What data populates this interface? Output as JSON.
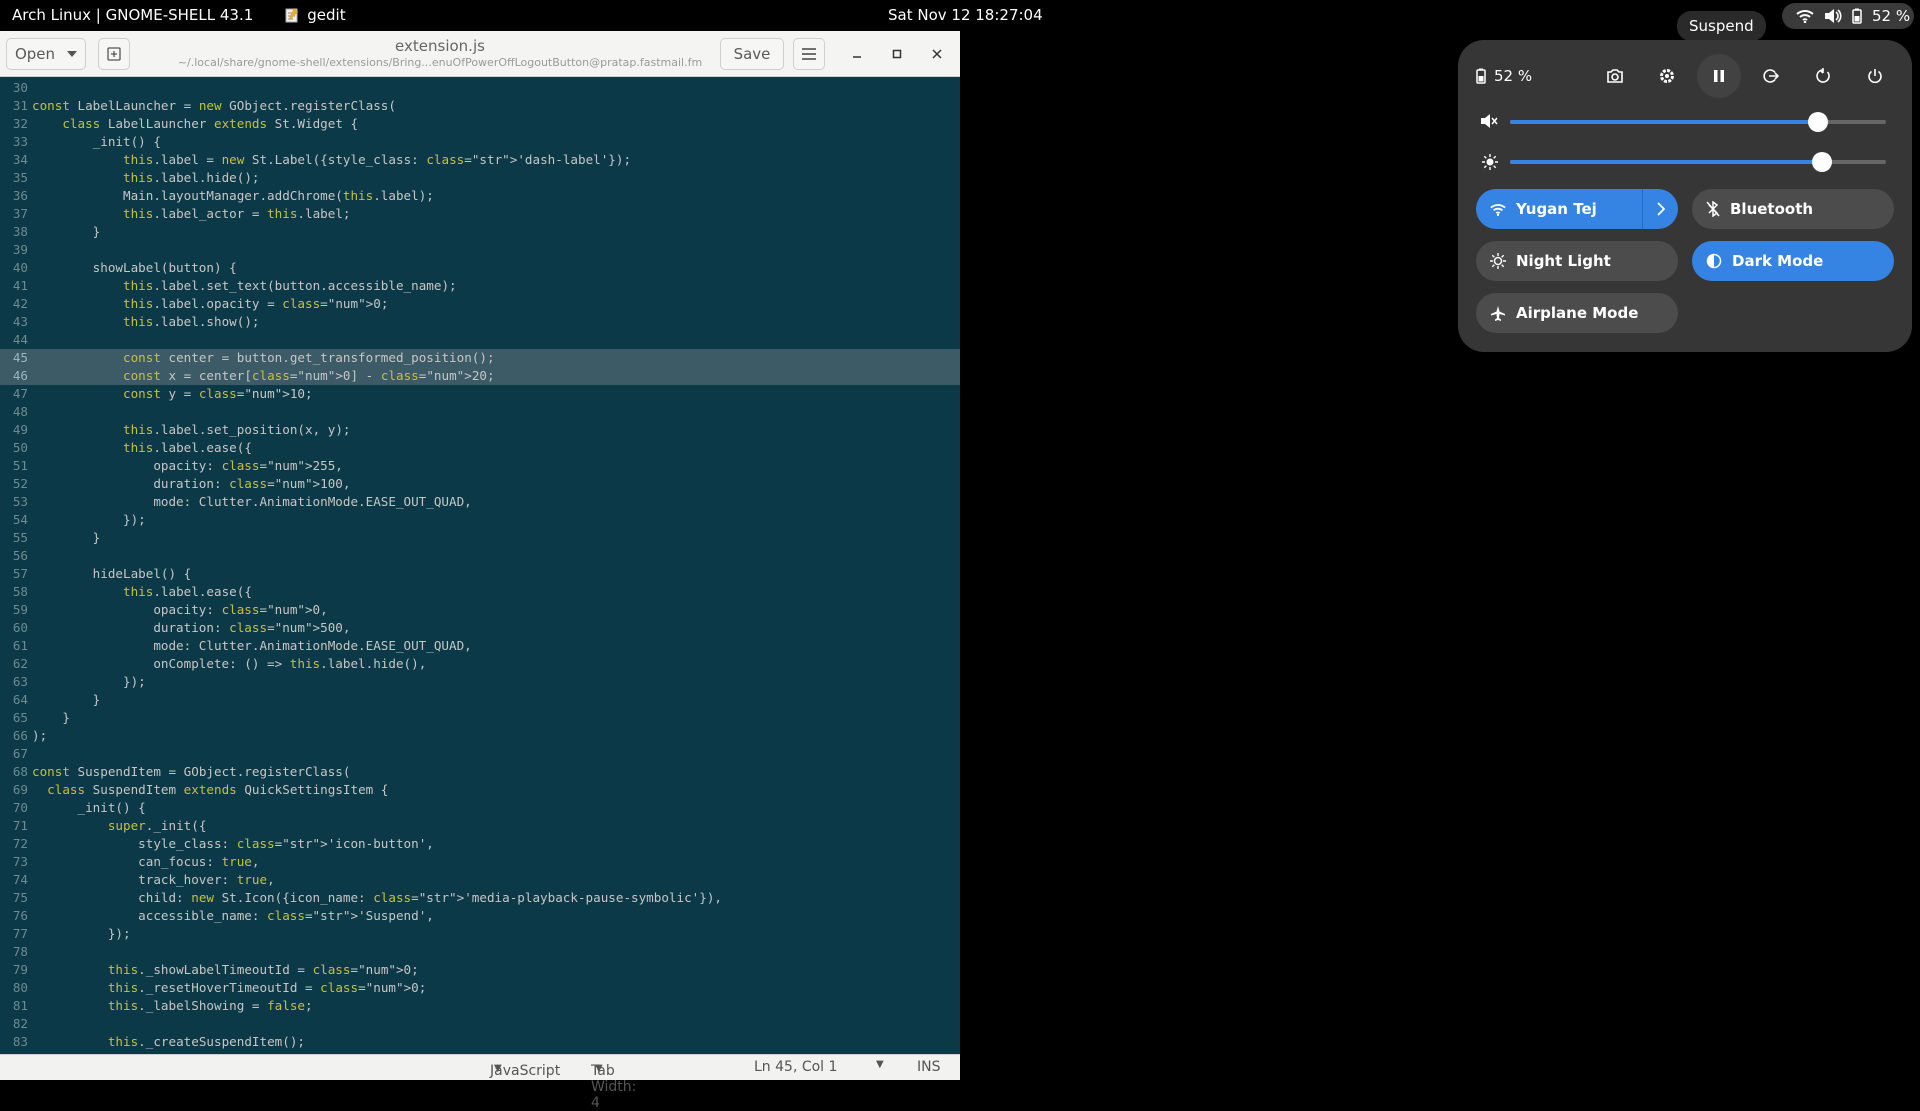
{
  "topbar": {
    "activities": "Arch Linux | GNOME-SHELL 43.1",
    "app_name": "gedit",
    "clock": "Sat Nov 12  18:27:04",
    "battery": "52 %"
  },
  "tooltip": "Suspend",
  "gedit": {
    "open_label": "Open",
    "title": "extension.js",
    "subtitle": "~/.local/share/gnome-shell/extensions/Bring...enuOfPowerOffLogoutButton@pratap.fastmail.fm",
    "save_label": "Save",
    "status": {
      "language": "JavaScript",
      "tab_width": "Tab Width: 4",
      "position": "Ln 45, Col 1",
      "mode": "INS"
    },
    "code_lines": [
      {
        "n": "30",
        "t": ""
      },
      {
        "n": "31",
        "t": "const LabelLauncher = new GObject.registerClass("
      },
      {
        "n": "32",
        "t": "    class LabelLauncher extends St.Widget {"
      },
      {
        "n": "33",
        "t": "        _init() {"
      },
      {
        "n": "34",
        "t": "            this.label = new St.Label({style_class: 'dash-label'});"
      },
      {
        "n": "35",
        "t": "            this.label.hide();"
      },
      {
        "n": "36",
        "t": "            Main.layoutManager.addChrome(this.label);"
      },
      {
        "n": "37",
        "t": "            this.label_actor = this.label;"
      },
      {
        "n": "38",
        "t": "        }"
      },
      {
        "n": "39",
        "t": ""
      },
      {
        "n": "40",
        "t": "        showLabel(button) {"
      },
      {
        "n": "41",
        "t": "            this.label.set_text(button.accessible_name);"
      },
      {
        "n": "42",
        "t": "            this.label.opacity = 0;"
      },
      {
        "n": "43",
        "t": "            this.label.show();"
      },
      {
        "n": "44",
        "t": ""
      },
      {
        "n": "45",
        "t": "            const center = button.get_transformed_position();"
      },
      {
        "n": "46",
        "t": "            const x = center[0] - 20;"
      },
      {
        "n": "47",
        "t": "            const y = 10;"
      },
      {
        "n": "48",
        "t": ""
      },
      {
        "n": "49",
        "t": "            this.label.set_position(x, y);"
      },
      {
        "n": "50",
        "t": "            this.label.ease({"
      },
      {
        "n": "51",
        "t": "                opacity: 255,"
      },
      {
        "n": "52",
        "t": "                duration: 100,"
      },
      {
        "n": "53",
        "t": "                mode: Clutter.AnimationMode.EASE_OUT_QUAD,"
      },
      {
        "n": "54",
        "t": "            });"
      },
      {
        "n": "55",
        "t": "        }"
      },
      {
        "n": "56",
        "t": ""
      },
      {
        "n": "57",
        "t": "        hideLabel() {"
      },
      {
        "n": "58",
        "t": "            this.label.ease({"
      },
      {
        "n": "59",
        "t": "                opacity: 0,"
      },
      {
        "n": "60",
        "t": "                duration: 500,"
      },
      {
        "n": "61",
        "t": "                mode: Clutter.AnimationMode.EASE_OUT_QUAD,"
      },
      {
        "n": "62",
        "t": "                onComplete: () => this.label.hide(),"
      },
      {
        "n": "63",
        "t": "            });"
      },
      {
        "n": "64",
        "t": "        }"
      },
      {
        "n": "65",
        "t": "    }"
      },
      {
        "n": "66",
        "t": ");"
      },
      {
        "n": "67",
        "t": ""
      },
      {
        "n": "68",
        "t": "const SuspendItem = GObject.registerClass("
      },
      {
        "n": "69",
        "t": "  class SuspendItem extends QuickSettingsItem {"
      },
      {
        "n": "70",
        "t": "      _init() {"
      },
      {
        "n": "71",
        "t": "          super._init({"
      },
      {
        "n": "72",
        "t": "              style_class: 'icon-button',"
      },
      {
        "n": "73",
        "t": "              can_focus: true,"
      },
      {
        "n": "74",
        "t": "              track_hover: true,"
      },
      {
        "n": "75",
        "t": "              child: new St.Icon({icon_name: 'media-playback-pause-symbolic'}),"
      },
      {
        "n": "76",
        "t": "              accessible_name: 'Suspend',"
      },
      {
        "n": "77",
        "t": "          });"
      },
      {
        "n": "78",
        "t": ""
      },
      {
        "n": "79",
        "t": "          this._showLabelTimeoutId = 0;"
      },
      {
        "n": "80",
        "t": "          this._resetHoverTimeoutId = 0;"
      },
      {
        "n": "81",
        "t": "          this._labelShowing = false;"
      },
      {
        "n": "82",
        "t": ""
      },
      {
        "n": "83",
        "t": "          this._createSuspendItem();"
      }
    ],
    "selected_lines": [
      "45",
      "46",
      "47"
    ]
  },
  "quick_settings": {
    "battery_label": "52 %",
    "icons": [
      "screenshot-icon",
      "settings-icon",
      "suspend-icon",
      "logout-icon",
      "restart-icon",
      "power-icon"
    ],
    "volume_level": 0.82,
    "brightness_level": 0.83,
    "toggles": {
      "wifi": "Yugan Tej",
      "bluetooth": "Bluetooth",
      "night_light": "Night Light",
      "dark_mode": "Dark Mode",
      "airplane": "Airplane Mode"
    },
    "accent": "#3584e4"
  }
}
